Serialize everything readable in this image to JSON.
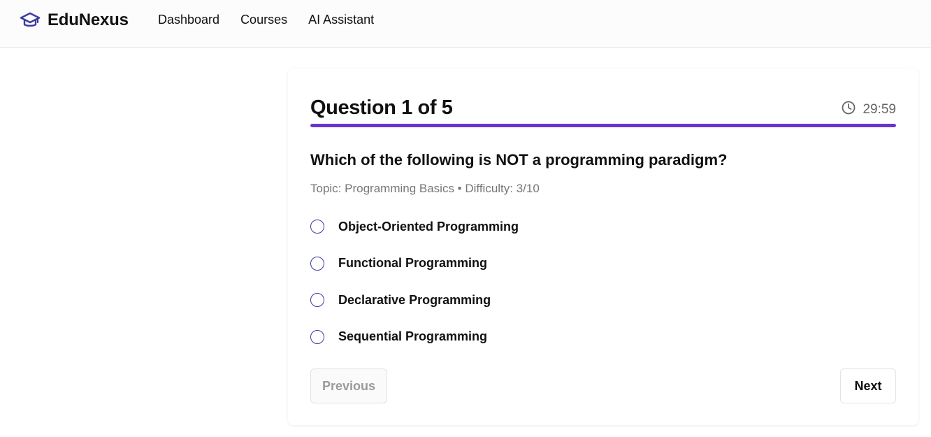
{
  "navbar": {
    "brand": "EduNexus",
    "brand_icon": "graduation-cap-icon",
    "brand_color": "#3b3aa0",
    "links": [
      {
        "label": "Dashboard"
      },
      {
        "label": "Courses"
      },
      {
        "label": "AI Assistant"
      }
    ]
  },
  "quiz": {
    "title": "Question 1 of 5",
    "timer": "29:59",
    "timer_icon": "clock-icon",
    "progress_percent": 100,
    "accent_color": "#6a35c9",
    "question": "Which of the following is NOT a programming paradigm?",
    "meta": "Topic: Programming Basics • Difficulty: 3/10",
    "options": [
      {
        "label": "Object-Oriented Programming",
        "selected": false
      },
      {
        "label": "Functional Programming",
        "selected": false
      },
      {
        "label": "Declarative Programming",
        "selected": false
      },
      {
        "label": "Sequential Programming",
        "selected": false
      }
    ],
    "previous_label": "Previous",
    "next_label": "Next"
  }
}
